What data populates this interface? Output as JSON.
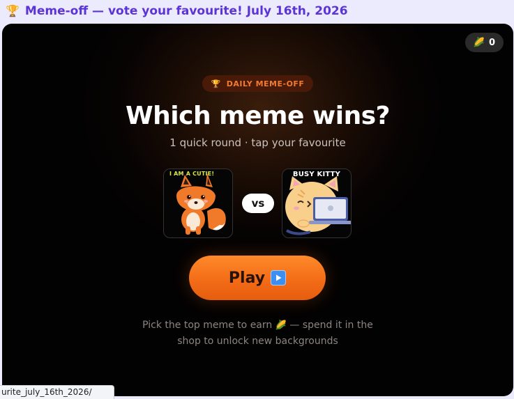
{
  "header": {
    "icon": "trophy-icon",
    "title": "Meme-off — vote your favourite! July 16th, 2026"
  },
  "coins": {
    "icon": "corn-icon",
    "count": "0"
  },
  "badge": {
    "icon": "trophy-icon",
    "label": "DAILY MEME-OFF"
  },
  "main": {
    "heading": "Which meme wins?",
    "subheading": "1 quick round · tap your favourite",
    "vs_label": "vs"
  },
  "memes": [
    {
      "caption": "I AM A CUTIE!",
      "subject": "fox"
    },
    {
      "caption": "BUSY KITTY",
      "subject": "cat-with-laptop"
    }
  ],
  "play_button": {
    "label": "Play",
    "icon": "play-icon"
  },
  "hint": {
    "line1_before": "Pick the top meme to earn",
    "line1_after": "— spend it in the",
    "line2": "shop to unlock new backgrounds",
    "icon": "corn-icon"
  },
  "status_bar": {
    "url": "urite_july_16th_2026/"
  },
  "colors": {
    "accent": "#f26a16",
    "header_text": "#5b34d6",
    "badge_text": "#f07a32"
  }
}
